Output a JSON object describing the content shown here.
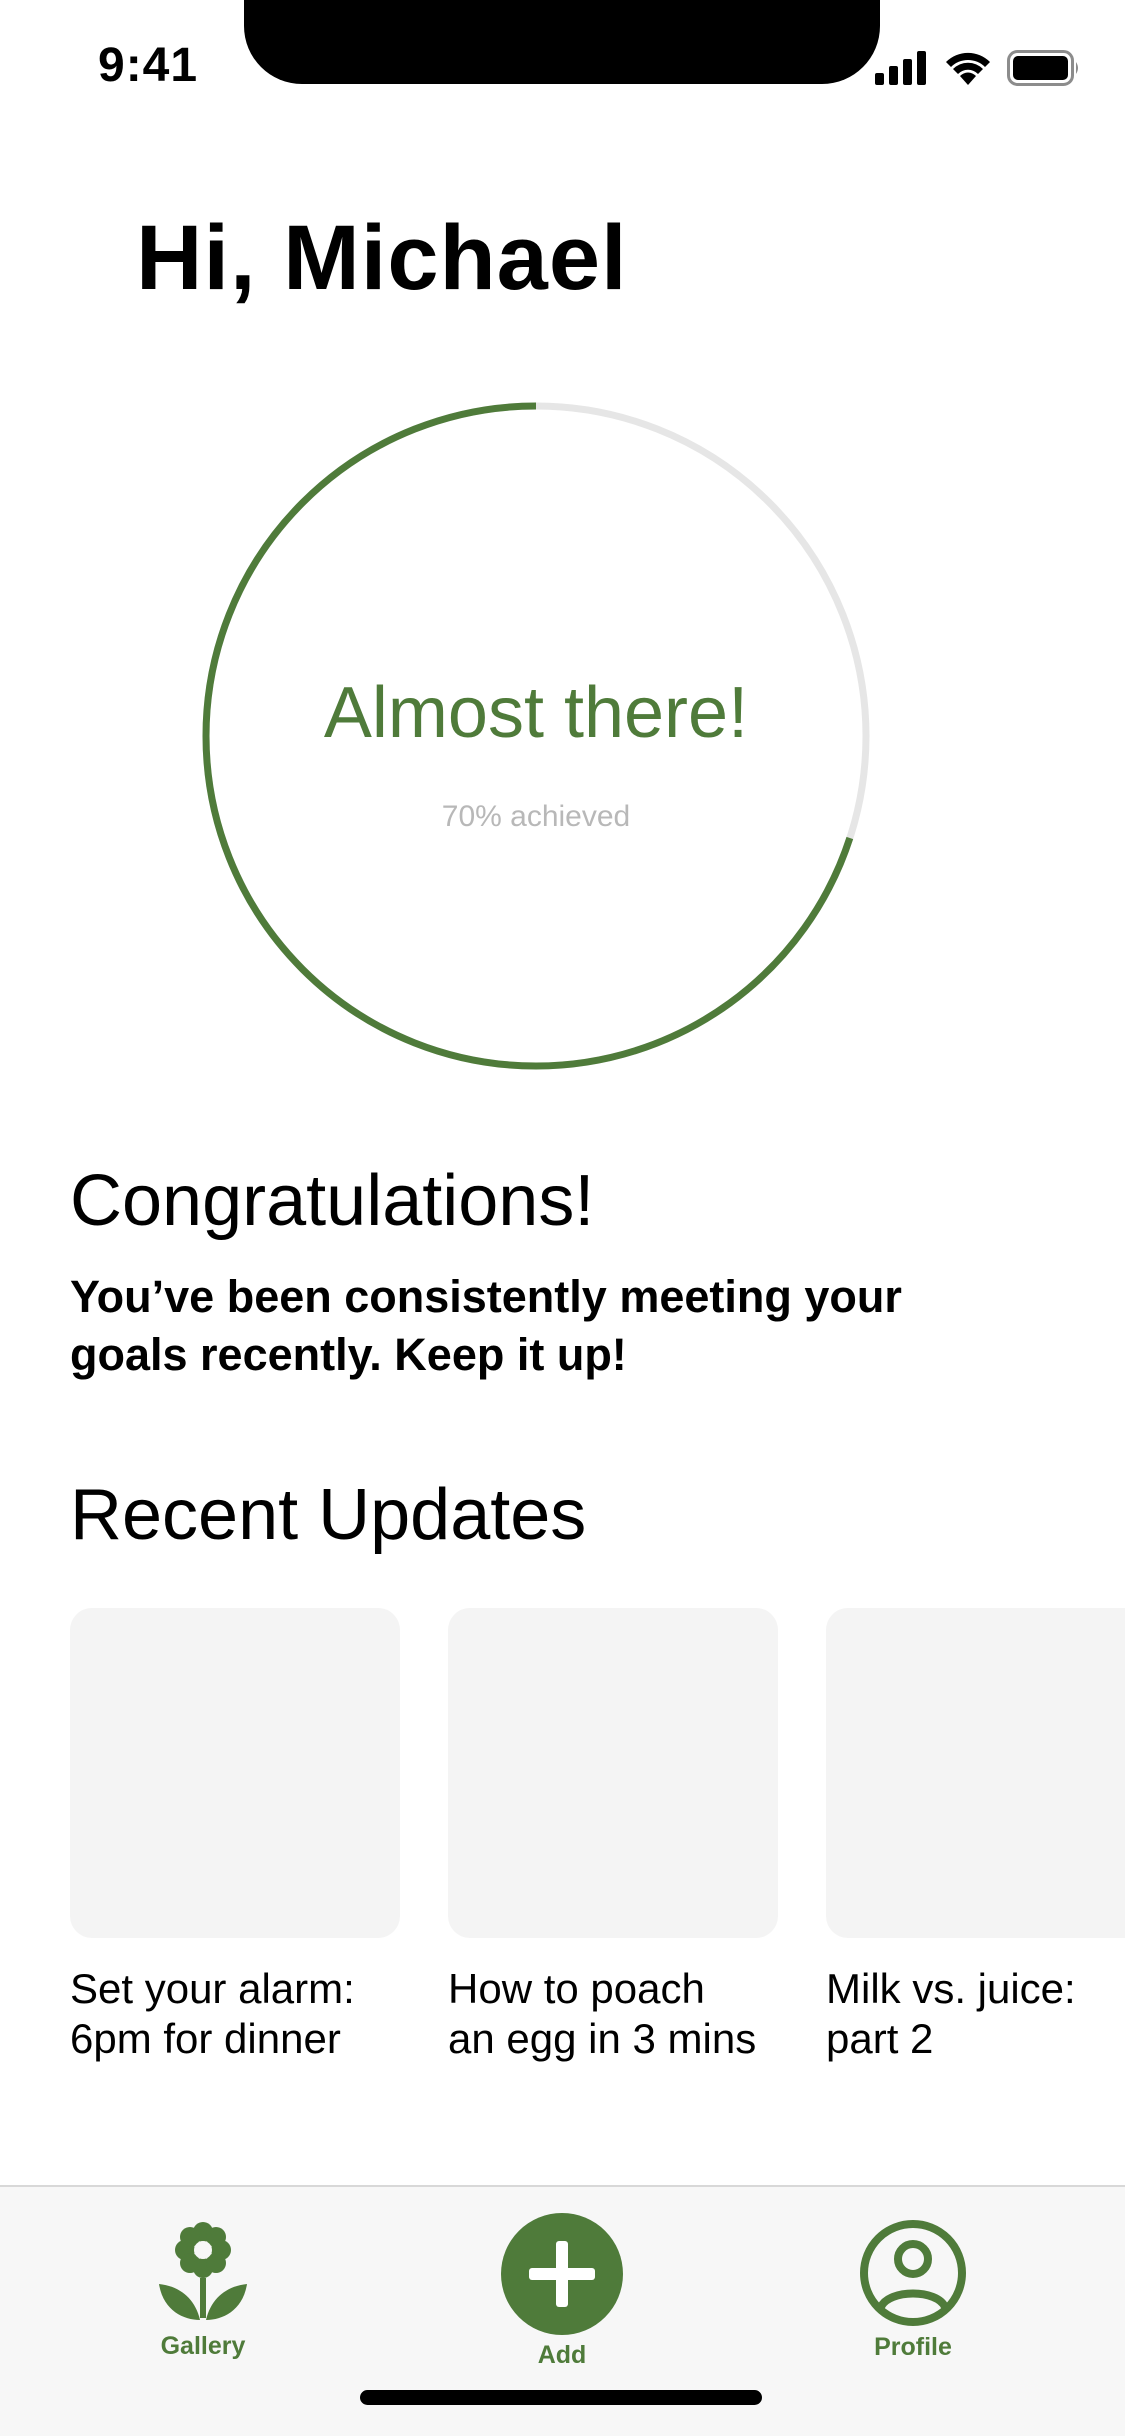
{
  "status_bar": {
    "time": "9:41"
  },
  "greeting": "Hi, Michael",
  "progress": {
    "title": "Almost there!",
    "subtitle": "70% achieved",
    "fraction": 0.7,
    "color": "#4f7b3a",
    "track_color": "#e6e6e6"
  },
  "congrats": {
    "title": "Congratulations!",
    "body": "You’ve been consistently meeting your goals recently. Keep it up!"
  },
  "updates": {
    "title": "Recent Updates",
    "cards": [
      {
        "text": "Set your alarm:\n6pm for dinner"
      },
      {
        "text": "How to poach\nan egg in 3 mins"
      },
      {
        "text": "Milk vs. juice:\npart 2"
      }
    ]
  },
  "tabbar": {
    "gallery": {
      "label": "Gallery",
      "icon": "flower-icon"
    },
    "add": {
      "label": "Add",
      "icon": "plus-icon"
    },
    "profile": {
      "label": "Profile",
      "icon": "user-circle-icon"
    },
    "accent_color": "#4f7b3a"
  }
}
